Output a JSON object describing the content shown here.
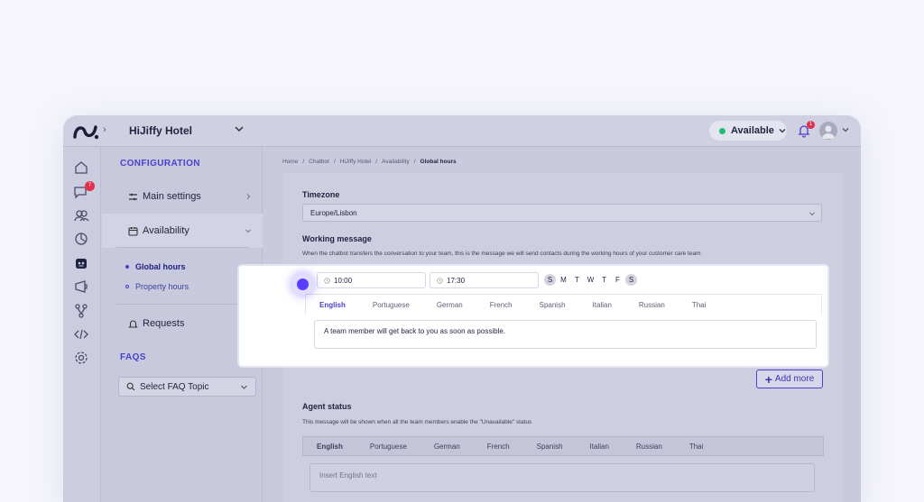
{
  "app": {
    "hotel_name": "HiJiffy Hotel",
    "status_label": "Available",
    "notification_count": "1",
    "chat_badge_count": "7"
  },
  "colors": {
    "accent": "#4d3fd0",
    "status_green": "#1fbf73",
    "badge_red": "#e0304b"
  },
  "rail": {
    "icons": [
      "home-icon",
      "chat-icon",
      "contacts-icon",
      "analytics-icon",
      "chatbot-icon",
      "campaigns-icon",
      "integrations-icon",
      "code-icon",
      "settings-icon"
    ]
  },
  "sidebar": {
    "section_title": "CONFIGURATION",
    "main_settings": "Main settings",
    "availability": "Availability",
    "global_hours": "Global hours",
    "property_hours": "Property hours",
    "requests": "Requests",
    "faqs_title": "FAQS",
    "faq_select_placeholder": "Select FAQ Topic"
  },
  "breadcrumb": {
    "home": "Home",
    "chatbot": "Chatbot",
    "hotel": "HiJiffy Hotel",
    "availability": "Availability",
    "current": "Global hours"
  },
  "timezone": {
    "label": "Timezone",
    "value": "Europe/Lisbon"
  },
  "working_message": {
    "label": "Working message",
    "description": "When the chatbot transfers the conversation to your team, this is the message we will send contacts during the working hours of your customer care team",
    "start_time": "10:00",
    "end_time": "17:30",
    "days": [
      {
        "letter": "S",
        "active": true
      },
      {
        "letter": "M",
        "active": false
      },
      {
        "letter": "T",
        "active": false
      },
      {
        "letter": "W",
        "active": false
      },
      {
        "letter": "T",
        "active": false
      },
      {
        "letter": "F",
        "active": false
      },
      {
        "letter": "S",
        "active": true
      }
    ],
    "languages": [
      "English",
      "Portuguese",
      "German",
      "French",
      "Spanish",
      "Italian",
      "Russian",
      "Thai"
    ],
    "active_language": "English",
    "message": "A team member will get back to you as soon as possible.",
    "add_more": "Add more"
  },
  "agent_status": {
    "label": "Agent status",
    "description": "This message will be shown when all the team members enable the \"Unavailable\" status",
    "languages": [
      "English",
      "Portuguese",
      "German",
      "French",
      "Spanish",
      "Italian",
      "Russian",
      "Thai"
    ],
    "placeholder": "Insert English text"
  }
}
